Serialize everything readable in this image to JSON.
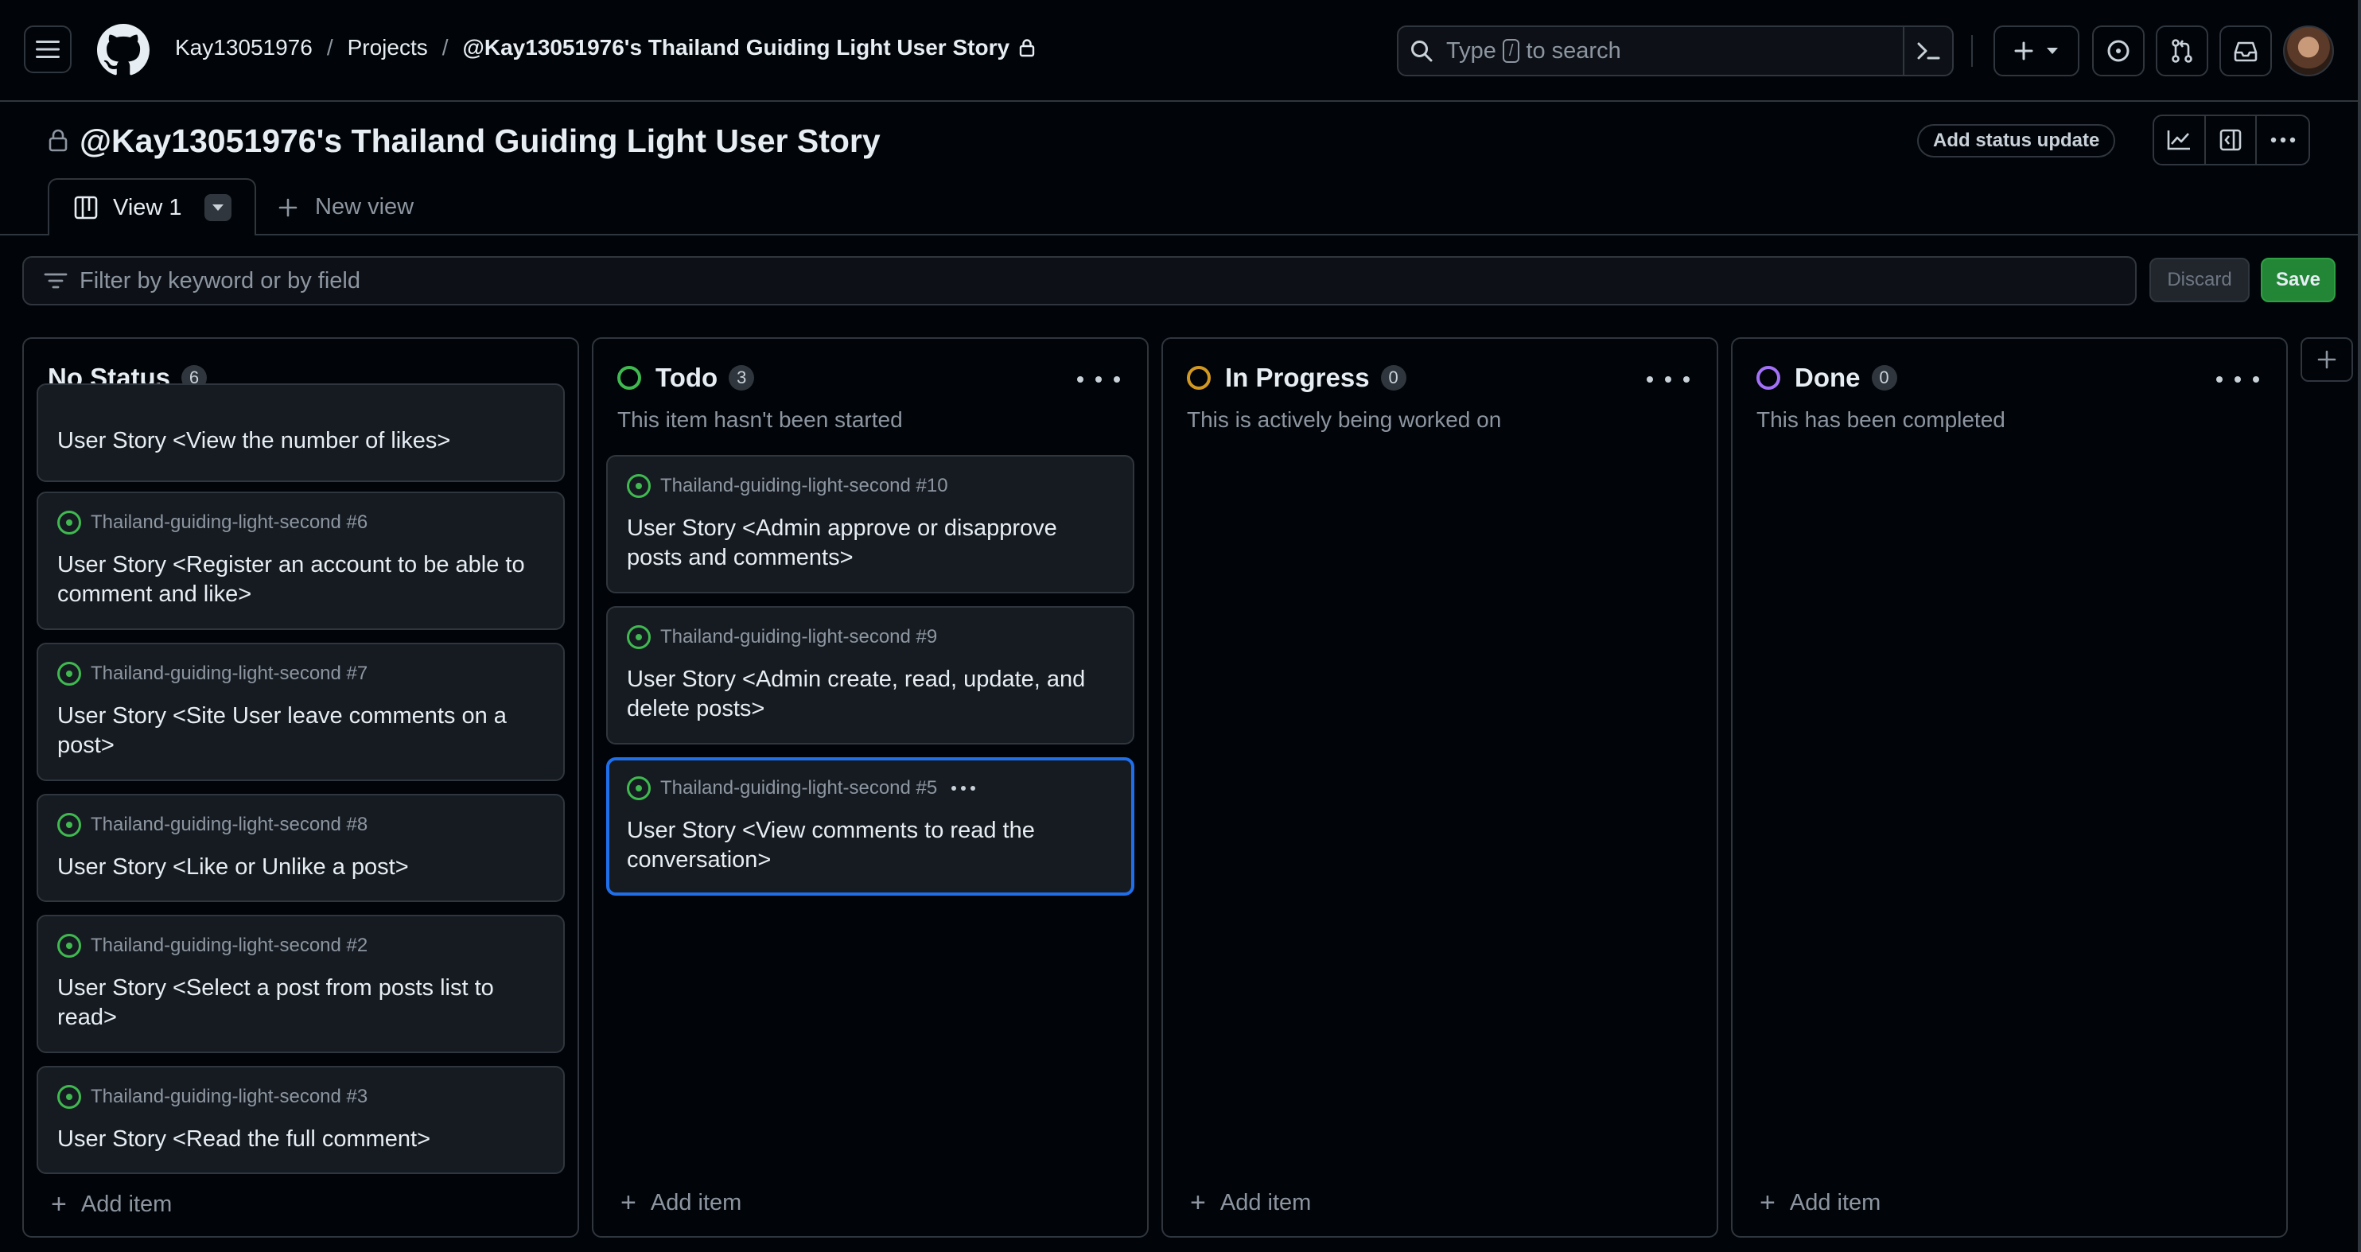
{
  "breadcrumb": {
    "owner": "Kay13051976",
    "projects": "Projects",
    "project": "@Kay13051976's Thailand Guiding Light User Story"
  },
  "search": {
    "prefix": "Type",
    "key": "/",
    "suffix": "to search"
  },
  "project": {
    "title": "@Kay13051976's Thailand Guiding Light User Story",
    "status_update": "Add status update"
  },
  "views": {
    "active": "View 1",
    "new_view": "New view"
  },
  "filter": {
    "placeholder": "Filter by keyword or by field",
    "discard": "Discard",
    "save": "Save"
  },
  "colors": {
    "todo": "#3fb950",
    "in_progress": "#d29922",
    "done": "#a371f7",
    "selected_border": "#1f6feb"
  },
  "columns": [
    {
      "name": "No Status",
      "count": "6",
      "description": "",
      "add_item": "Add item",
      "cards": [
        {
          "meta": "",
          "title": "User Story <View the number of likes>"
        },
        {
          "meta": "Thailand-guiding-light-second #6",
          "title": "User Story <Register an account to be able to comment and like>"
        },
        {
          "meta": "Thailand-guiding-light-second #7",
          "title": "User Story <Site User leave comments on a post>"
        },
        {
          "meta": "Thailand-guiding-light-second #8",
          "title": "User Story <Like or Unlike a post>"
        },
        {
          "meta": "Thailand-guiding-light-second #2",
          "title": "User Story <Select a post from posts list to read>"
        },
        {
          "meta": "Thailand-guiding-light-second #3",
          "title": "User Story <Read the full comment>"
        }
      ]
    },
    {
      "name": "Todo",
      "count": "3",
      "description": "This item hasn't been started",
      "add_item": "Add item",
      "cards": [
        {
          "meta": "Thailand-guiding-light-second #10",
          "title": "User Story <Admin approve or disapprove posts and comments>"
        },
        {
          "meta": "Thailand-guiding-light-second #9",
          "title": "User Story <Admin create, read, update, and delete posts>"
        },
        {
          "meta": "Thailand-guiding-light-second #5",
          "title": "User Story <View comments to read the conversation>"
        }
      ]
    },
    {
      "name": "In Progress",
      "count": "0",
      "description": "This is actively being worked on",
      "add_item": "Add item",
      "cards": []
    },
    {
      "name": "Done",
      "count": "0",
      "description": "This has been completed",
      "add_item": "Add item",
      "cards": []
    }
  ]
}
